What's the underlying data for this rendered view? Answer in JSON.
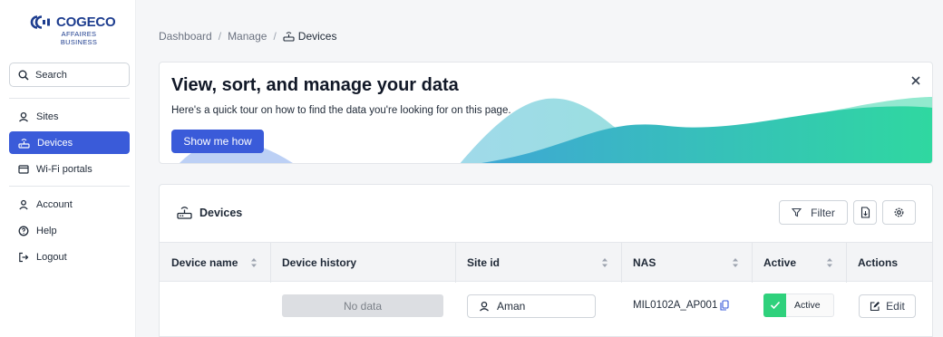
{
  "sidebar": {
    "logo": {
      "name": "COGECO",
      "sub_line1": "AFFAIRES",
      "sub_line2": "BUSINESS"
    },
    "search_label": "Search",
    "items": [
      {
        "label": "Sites",
        "icon": "pin-icon",
        "active": false
      },
      {
        "label": "Devices",
        "icon": "router-icon",
        "active": true
      },
      {
        "label": "Wi-Fi portals",
        "icon": "browser-window-icon",
        "active": false
      }
    ],
    "account_items": [
      {
        "label": "Account",
        "icon": "user-icon"
      },
      {
        "label": "Help",
        "icon": "help-circle-icon"
      },
      {
        "label": "Logout",
        "icon": "logout-icon"
      }
    ]
  },
  "breadcrumb": {
    "items": [
      "Dashboard",
      "Manage"
    ],
    "current": "Devices",
    "separator": "/"
  },
  "banner": {
    "title": "View, sort, and manage your data",
    "text": "Here's a quick tour on how to find the data you're looking for on this page.",
    "button_label": "Show me how"
  },
  "devices_card": {
    "title": "Devices",
    "filter_label": "Filter",
    "columns": [
      "Device name",
      "Device history",
      "Site id",
      "NAS",
      "Active",
      "Actions"
    ],
    "rows": [
      {
        "device_name": "",
        "device_history": "No data",
        "site_id": "Aman",
        "nas": "MIL0102A_AP001",
        "active": "Active",
        "action_label": "Edit"
      }
    ]
  },
  "colors": {
    "accent": "#3a5bd9",
    "active_green": "#2fd17c",
    "brand": "#1d3d8f"
  }
}
